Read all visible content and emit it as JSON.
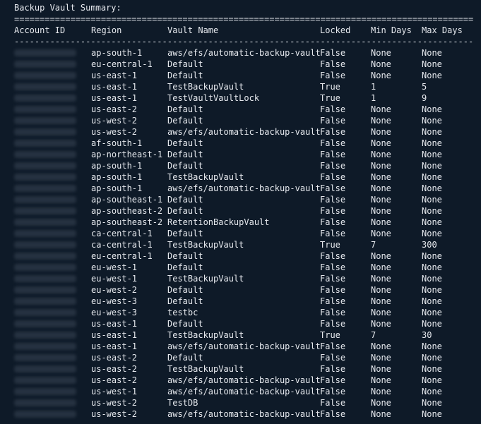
{
  "title": "Backup Vault Summary:",
  "separator_top": "==================================================================================================",
  "separator_mid": "--------------------------------------------------------------------------------------------------",
  "headers": {
    "account_id": "Account ID",
    "region": "Region",
    "vault_name": "Vault Name",
    "locked": "Locked",
    "min_days": "Min Days",
    "max_days": "Max Days"
  },
  "rows": [
    {
      "region": "ap-south-1",
      "vault": "aws/efs/automatic-backup-vault",
      "locked": "False",
      "min": "None",
      "max": "None"
    },
    {
      "region": "eu-central-1",
      "vault": "Default",
      "locked": "False",
      "min": "None",
      "max": "None"
    },
    {
      "region": "us-east-1",
      "vault": "Default",
      "locked": "False",
      "min": "None",
      "max": "None"
    },
    {
      "region": "us-east-1",
      "vault": "TestBackupVault",
      "locked": "True",
      "min": "1",
      "max": "5"
    },
    {
      "region": "us-east-1",
      "vault": "TestVaultVaultLock",
      "locked": "True",
      "min": "1",
      "max": "9"
    },
    {
      "region": "us-east-2",
      "vault": "Default",
      "locked": "False",
      "min": "None",
      "max": "None"
    },
    {
      "region": "us-west-2",
      "vault": "Default",
      "locked": "False",
      "min": "None",
      "max": "None"
    },
    {
      "region": "us-west-2",
      "vault": "aws/efs/automatic-backup-vault",
      "locked": "False",
      "min": "None",
      "max": "None"
    },
    {
      "region": "af-south-1",
      "vault": "Default",
      "locked": "False",
      "min": "None",
      "max": "None"
    },
    {
      "region": "ap-northeast-1",
      "vault": "Default",
      "locked": "False",
      "min": "None",
      "max": "None"
    },
    {
      "region": "ap-south-1",
      "vault": "Default",
      "locked": "False",
      "min": "None",
      "max": "None"
    },
    {
      "region": "ap-south-1",
      "vault": "TestBackupVault",
      "locked": "False",
      "min": "None",
      "max": "None"
    },
    {
      "region": "ap-south-1",
      "vault": "aws/efs/automatic-backup-vault",
      "locked": "False",
      "min": "None",
      "max": "None"
    },
    {
      "region": "ap-southeast-1",
      "vault": "Default",
      "locked": "False",
      "min": "None",
      "max": "None"
    },
    {
      "region": "ap-southeast-2",
      "vault": "Default",
      "locked": "False",
      "min": "None",
      "max": "None"
    },
    {
      "region": "ap-southeast-2",
      "vault": "RetentionBackupVault",
      "locked": "False",
      "min": "None",
      "max": "None"
    },
    {
      "region": "ca-central-1",
      "vault": "Default",
      "locked": "False",
      "min": "None",
      "max": "None"
    },
    {
      "region": "ca-central-1",
      "vault": "TestBackupVault",
      "locked": "True",
      "min": "7",
      "max": "300"
    },
    {
      "region": "eu-central-1",
      "vault": "Default",
      "locked": "False",
      "min": "None",
      "max": "None"
    },
    {
      "region": "eu-west-1",
      "vault": "Default",
      "locked": "False",
      "min": "None",
      "max": "None"
    },
    {
      "region": "eu-west-1",
      "vault": "TestBackupVault",
      "locked": "False",
      "min": "None",
      "max": "None"
    },
    {
      "region": "eu-west-2",
      "vault": "Default",
      "locked": "False",
      "min": "None",
      "max": "None"
    },
    {
      "region": "eu-west-3",
      "vault": "Default",
      "locked": "False",
      "min": "None",
      "max": "None"
    },
    {
      "region": "eu-west-3",
      "vault": "testbc",
      "locked": "False",
      "min": "None",
      "max": "None"
    },
    {
      "region": "us-east-1",
      "vault": "Default",
      "locked": "False",
      "min": "None",
      "max": "None"
    },
    {
      "region": "us-east-1",
      "vault": "TestBackupVault",
      "locked": "True",
      "min": "7",
      "max": "30"
    },
    {
      "region": "us-east-1",
      "vault": "aws/efs/automatic-backup-vault",
      "locked": "False",
      "min": "None",
      "max": "None"
    },
    {
      "region": "us-east-2",
      "vault": "Default",
      "locked": "False",
      "min": "None",
      "max": "None"
    },
    {
      "region": "us-east-2",
      "vault": "TestBackupVault",
      "locked": "False",
      "min": "None",
      "max": "None"
    },
    {
      "region": "us-east-2",
      "vault": "aws/efs/automatic-backup-vault",
      "locked": "False",
      "min": "None",
      "max": "None"
    },
    {
      "region": "us-west-1",
      "vault": "aws/efs/automatic-backup-vault",
      "locked": "False",
      "min": "None",
      "max": "None"
    },
    {
      "region": "us-west-2",
      "vault": "TestDB",
      "locked": "False",
      "min": "None",
      "max": "None"
    },
    {
      "region": "us-west-2",
      "vault": "aws/efs/automatic-backup-vault",
      "locked": "False",
      "min": "None",
      "max": "None"
    }
  ]
}
